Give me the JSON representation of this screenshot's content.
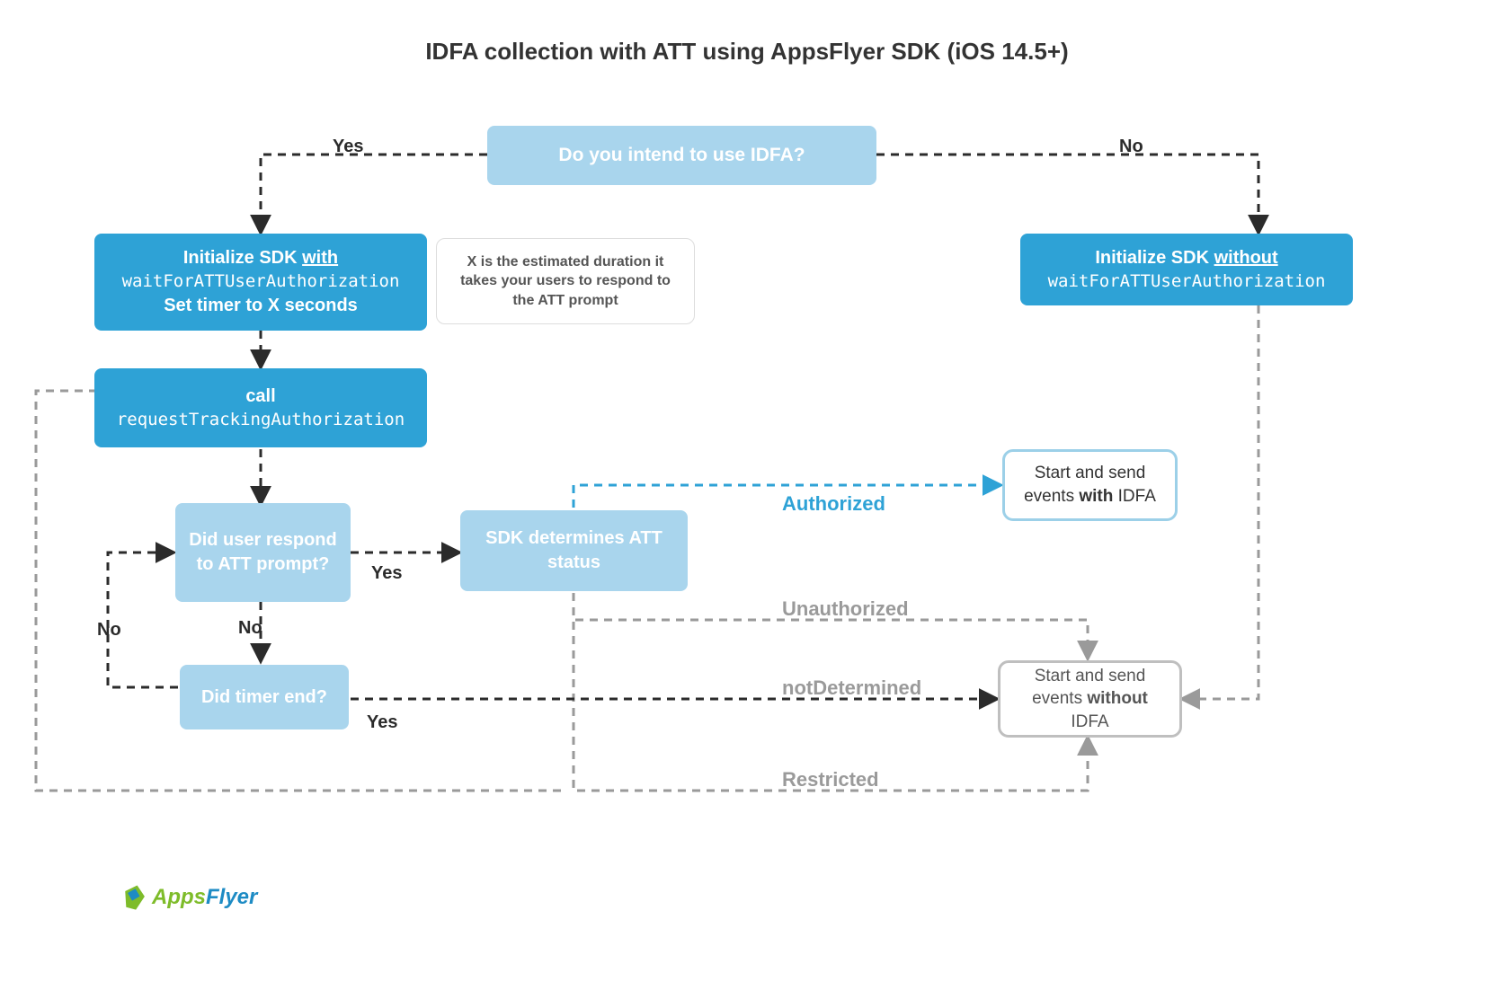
{
  "title": "IDFA collection with ATT using AppsFlyer SDK (iOS 14.5+)",
  "colors": {
    "light_blue": "#a9d5ed",
    "dark_blue": "#2ea2d6",
    "gray": "#9a9a9a",
    "edge_dark": "#2b2b2b"
  },
  "nodes": {
    "q_idfa": "Do you intend to use IDFA?",
    "init_with_1": "Initialize SDK ",
    "init_with_2": "with",
    "init_with_code": "waitForATTUserAuthorization",
    "init_with_3": "Set timer to X seconds",
    "note_x": "X is the estimated duration it takes your users to respond to the ATT prompt",
    "init_without_1": "Initialize SDK ",
    "init_without_2": "without",
    "init_without_code": "waitForATTUserAuthorization",
    "call_1": "call",
    "call_code": "requestTrackingAuthorization",
    "q_respond": "Did user respond to ATT prompt?",
    "q_timer": "Did timer end?",
    "sdk_status": "SDK determines ATT status",
    "result_with_1": "Start and send events ",
    "result_with_2": "with",
    "result_with_3": " IDFA",
    "result_without_1": "Start and send events ",
    "result_without_2": "without",
    "result_without_3": " IDFA"
  },
  "labels": {
    "yes1": "Yes",
    "no1": "No",
    "yes2": "Yes",
    "no2": "No",
    "yes3": "Yes",
    "no3": "No",
    "authorized": "Authorized",
    "unauthorized": "Unauthorized",
    "notDetermined": "notDetermined",
    "restricted": "Restricted"
  },
  "brand": {
    "a": "Apps",
    "b": "Flyer"
  }
}
